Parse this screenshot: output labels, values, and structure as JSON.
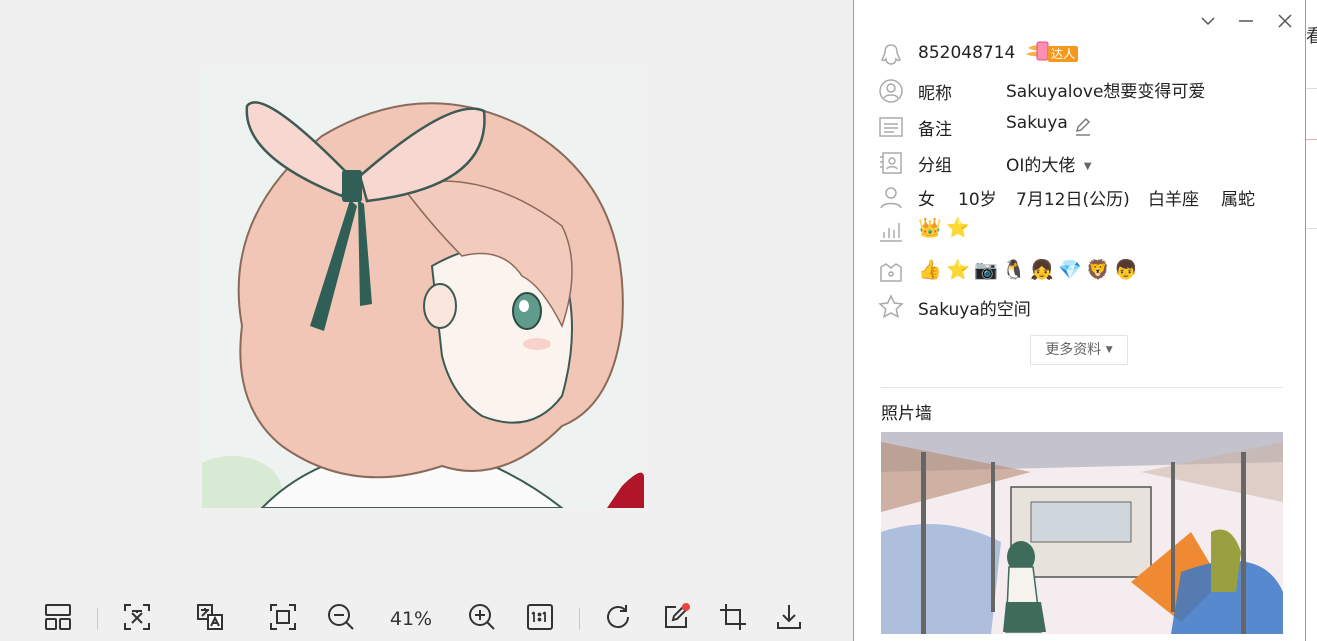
{
  "viewer": {
    "zoom_level": "41%",
    "tools": [
      "layout-icon",
      "ocr-text-icon",
      "translate-icon",
      "fit-screen-icon",
      "zoom-out-icon",
      "zoom-in-icon",
      "actual-size-icon",
      "rotate-icon",
      "edit-icon",
      "crop-icon",
      "download-icon"
    ]
  },
  "panel": {
    "window_controls": [
      "chevron-down-icon",
      "minimize-icon",
      "close-icon"
    ],
    "qq_number": "852048714",
    "expert_badge": "达人",
    "nickname_label": "昵称",
    "nickname": "Sakuyalove想要变得可爱",
    "remark_label": "备注",
    "remark": "Sakuya",
    "group_label": "分组",
    "group": "OI的大佬",
    "gender": "女",
    "age": "10岁",
    "birthday": "7月12日(公历)",
    "zodiac": "白羊座",
    "chinese_zodiac": "属蛇",
    "level_badges": [
      "👑",
      "⭐"
    ],
    "service_badges": [
      "👍",
      "⭐",
      "📷",
      "🐧",
      "👧",
      "💎",
      "🦁",
      "👦"
    ],
    "space": "Sakuya的空间",
    "more_info": "更多资料",
    "photo_wall_title": "照片墙"
  },
  "edge": {
    "char": "看"
  },
  "colors": {
    "panel_border": "#9aa18a",
    "badge_orange": "#f39a1e",
    "notification_dot": "#e8453c"
  }
}
